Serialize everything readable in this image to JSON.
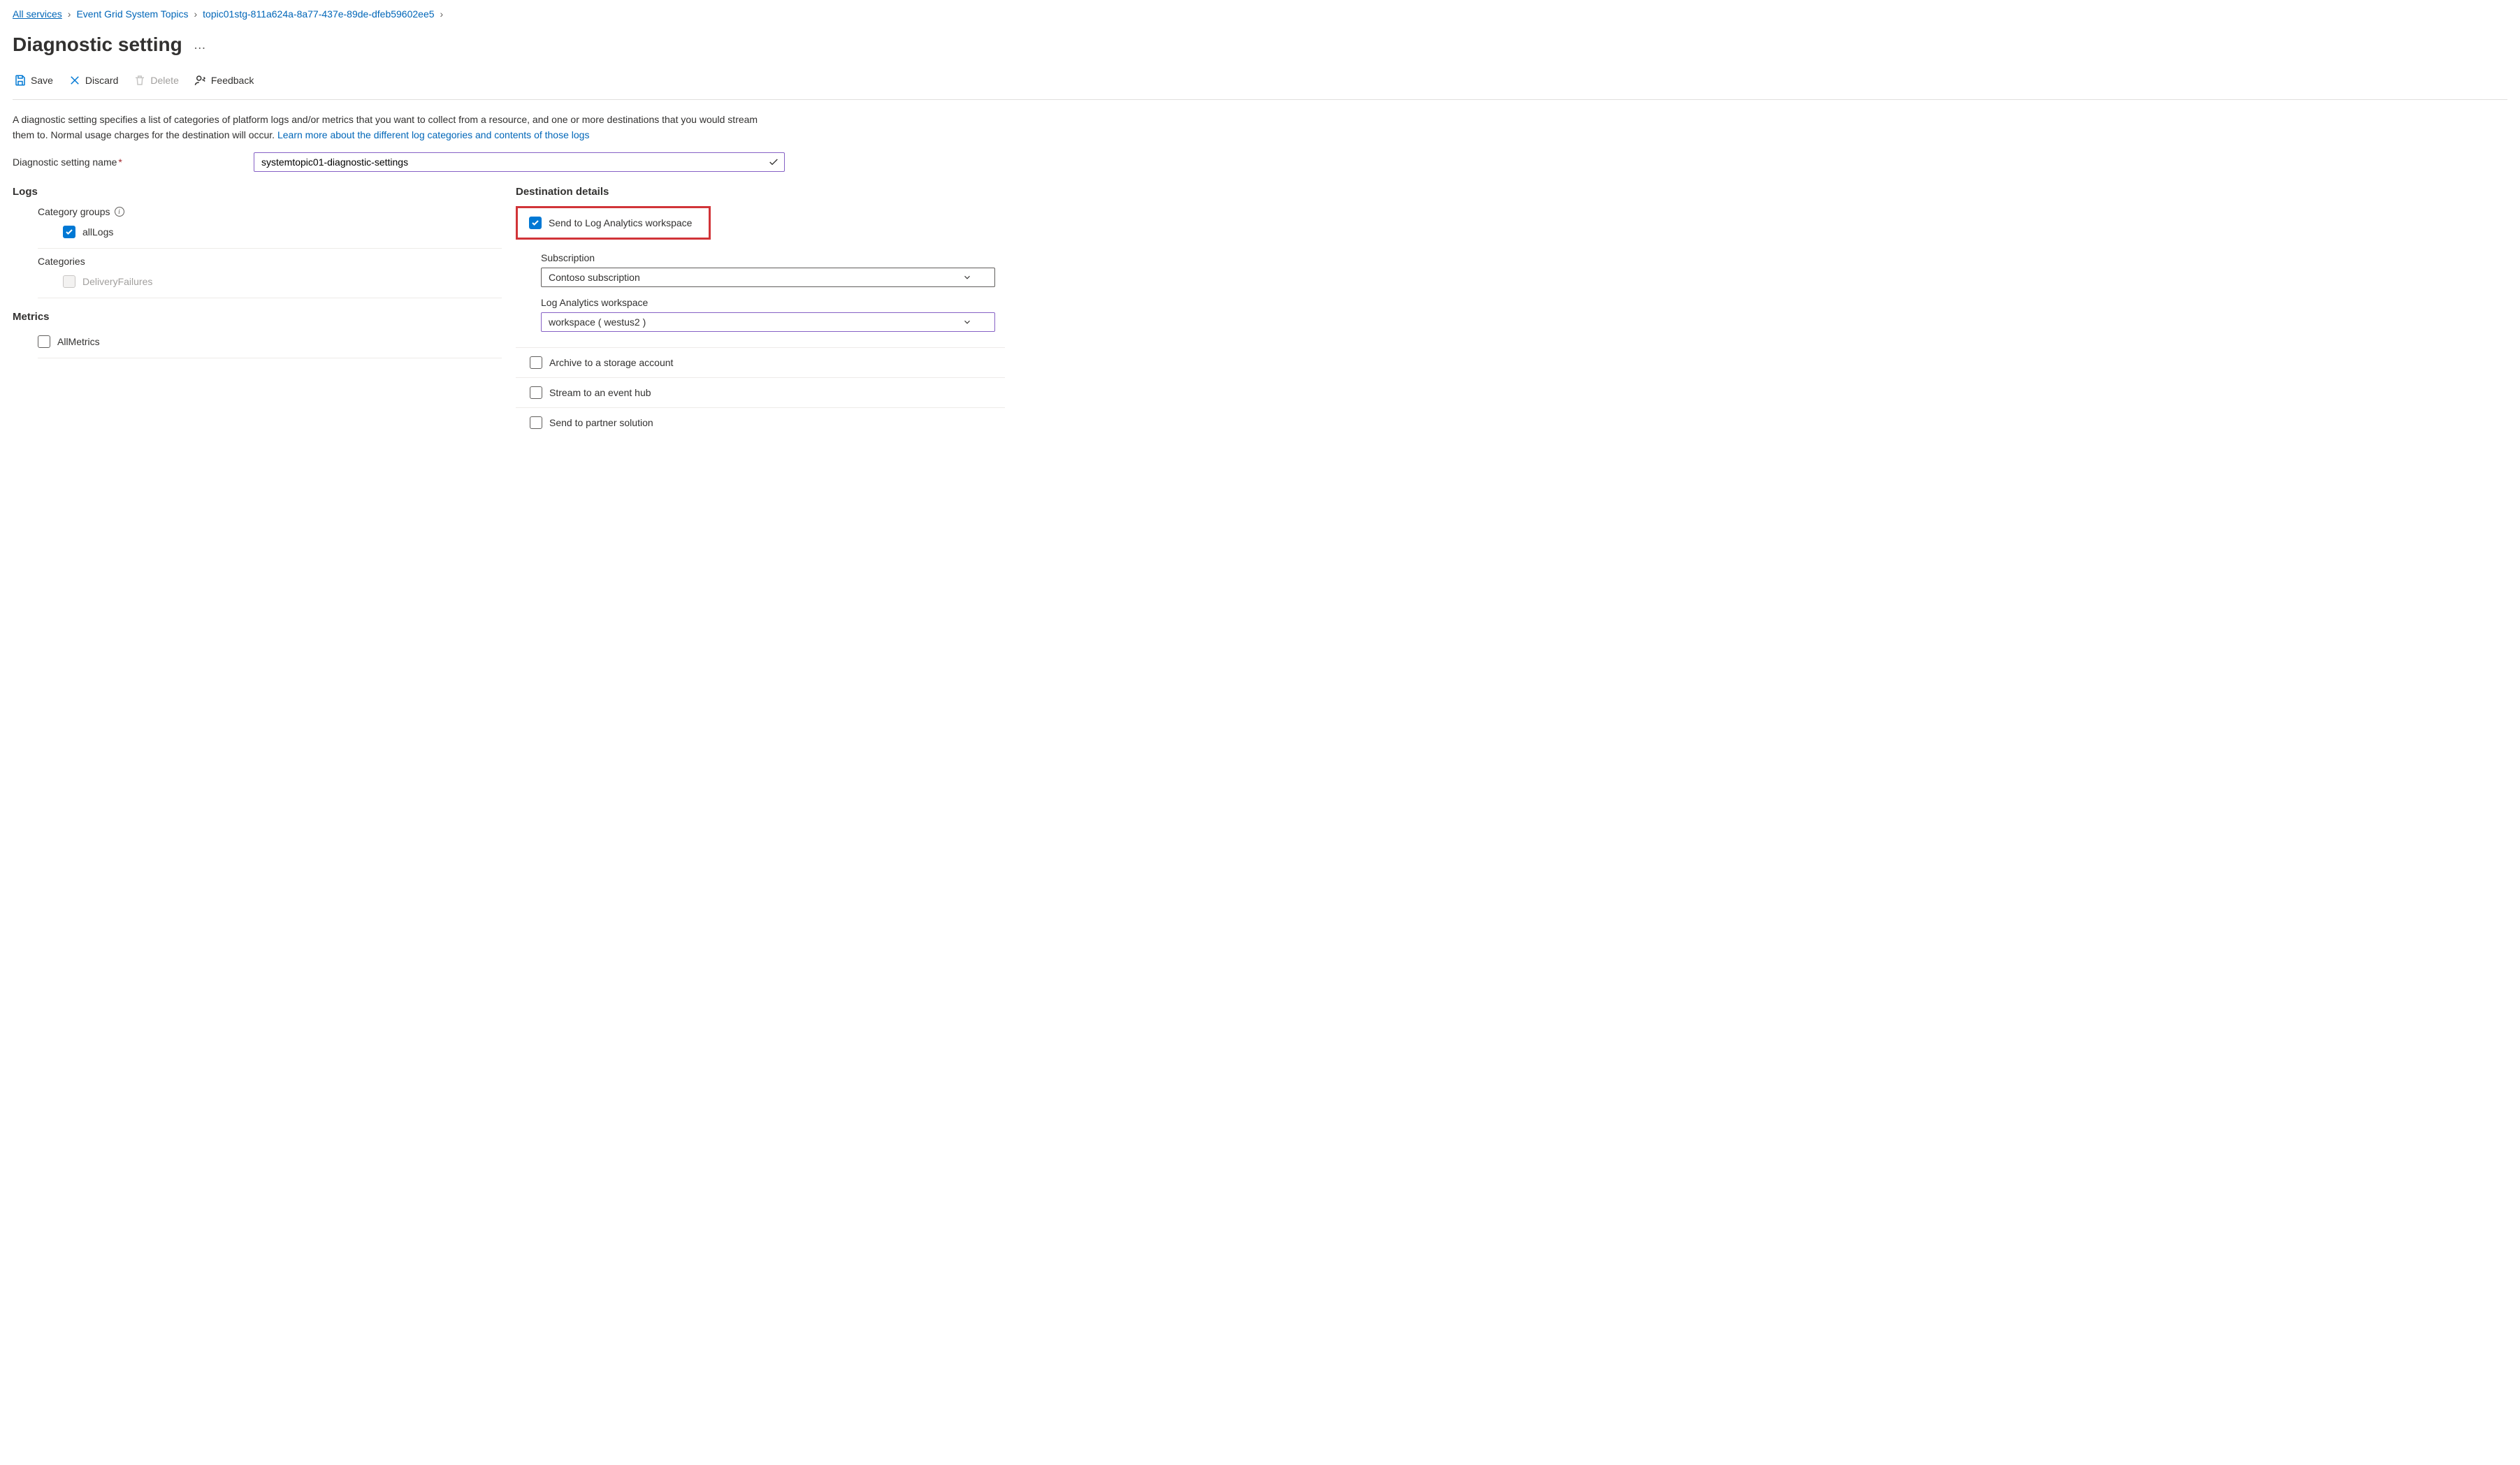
{
  "breadcrumb": {
    "all_services": "All services",
    "system_topics": "Event Grid System Topics",
    "topic_name": "topic01stg-811a624a-8a77-437e-89de-dfeb59602ee5"
  },
  "page_title": "Diagnostic setting",
  "toolbar": {
    "save": "Save",
    "discard": "Discard",
    "delete": "Delete",
    "feedback": "Feedback"
  },
  "description": {
    "text1": "A diagnostic setting specifies a list of categories of platform logs and/or metrics that you want to collect from a resource, and one or more destinations that you would stream them to. Normal usage charges for the destination will occur. ",
    "learn_link": "Learn more about the different log categories and contents of those logs"
  },
  "name_field": {
    "label": "Diagnostic setting name",
    "value": "systemtopic01-diagnostic-settings"
  },
  "logs": {
    "section": "Logs",
    "category_groups_label": "Category groups",
    "all_logs": "allLogs",
    "categories_label": "Categories",
    "delivery_failures": "DeliveryFailures"
  },
  "metrics": {
    "section": "Metrics",
    "all_metrics": "AllMetrics"
  },
  "destination": {
    "section": "Destination details",
    "send_log_analytics": "Send to Log Analytics workspace",
    "subscription_label": "Subscription",
    "subscription_value": "Contoso subscription",
    "workspace_label": "Log Analytics workspace",
    "workspace_value": "workspace ( westus2 )",
    "archive_storage": "Archive to a storage account",
    "stream_event_hub": "Stream to an event hub",
    "send_partner": "Send to partner solution"
  }
}
